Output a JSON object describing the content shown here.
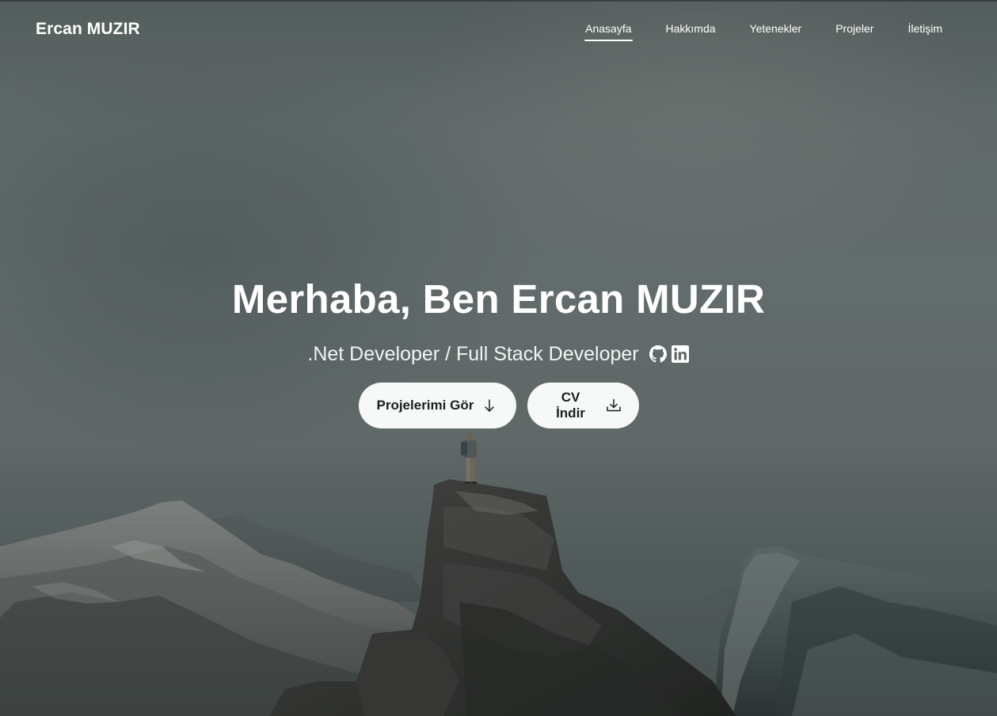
{
  "brand": "Ercan MUZIR",
  "nav": {
    "items": [
      {
        "label": "Anasayfa",
        "active": true
      },
      {
        "label": "Hakkımda",
        "active": false
      },
      {
        "label": "Yetenekler",
        "active": false
      },
      {
        "label": "Projeler",
        "active": false
      },
      {
        "label": "İletişim",
        "active": false
      }
    ]
  },
  "hero": {
    "title": "Merhaba, Ben Ercan MUZIR",
    "subtitle": ".Net Developer / Full Stack Developer",
    "social_icons": [
      "github-icon",
      "linkedin-icon"
    ],
    "buttons": {
      "projects_label": "Projelerimi Gör",
      "projects_icon": "arrow-down-icon",
      "cv_label": "CV İndir",
      "cv_icon": "download-icon"
    }
  },
  "background": {
    "description_icon": "mountain-hiker-photo",
    "overlay_color": "#6f7878"
  }
}
